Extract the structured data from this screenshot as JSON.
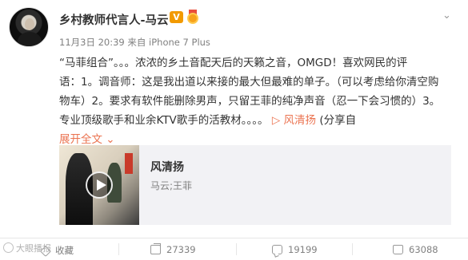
{
  "post": {
    "author": "乡村教师代言人-马云",
    "verified_badge": "V",
    "timestamp": "11月3日 20:39 来自 iPhone 7 Plus",
    "content_lines": [
      "“马菲组合”。。。浓浓的乡土音配天后的天籁之音，OMGD！喜欢网民的评",
      "语：1。调音师：这是我出道以来接的最大但最难的单子。（可以考虑给你清空购",
      "物车）2。要求有软件能删除男声，只留王菲的纯净声音（忍一下会习惯的）3。",
      "专业顶级歌手和业余KTV歌手的活教材。。。。"
    ],
    "music_link": "▷ 风清扬",
    "share_suffix": " (分享自",
    "expand_label": "展开全文 ⌄"
  },
  "music_card": {
    "title": "风清扬",
    "artist": "马云;王菲"
  },
  "actions": {
    "favorite": "收藏",
    "repost_count": "27339",
    "comment_count": "19199",
    "like_count": "63088"
  },
  "watermark": "大眼播报",
  "icons": [
    "avatar",
    "verified-icon",
    "medal-icon",
    "chevron-down-icon",
    "play-icon",
    "star-icon",
    "share-icon",
    "comment-icon",
    "like-icon"
  ],
  "colors": {
    "link": "#eb7350",
    "badge": "#f29a00",
    "muted": "#808080"
  }
}
